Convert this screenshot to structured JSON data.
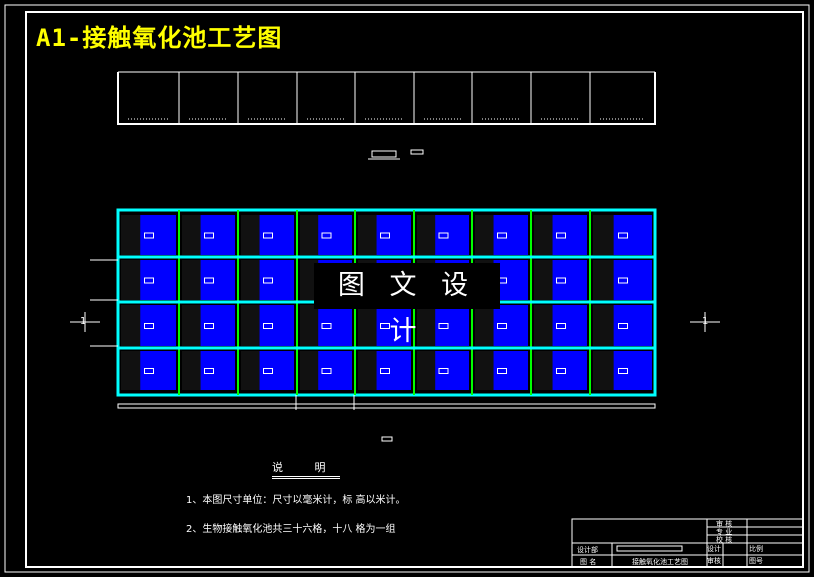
{
  "title": "A1-接触氧化池工艺图",
  "watermark": "图 文 设 计",
  "section_marker": "1",
  "notes": {
    "heading": "说 明",
    "items": [
      "1、本图尺寸单位：尺寸以毫米计，标  高以米计。",
      "2、生物接触氧化池共三十六格，十八  格为一组"
    ]
  },
  "title_block": {
    "rows_right": [
      "审 核",
      "专 业",
      "校 核"
    ],
    "design_dept": "设计部",
    "drawing_name_label": "图 名",
    "drawing_name": "接触氧化池工艺图",
    "design": "设计",
    "review": "审核",
    "scale": "比例",
    "drawing_no": "图号"
  },
  "colors": {
    "frame": "#ffffff",
    "title": "#ffff00",
    "cell_fill": "#0000ff",
    "wall": "#00ffff",
    "divider": "#00ff00"
  }
}
